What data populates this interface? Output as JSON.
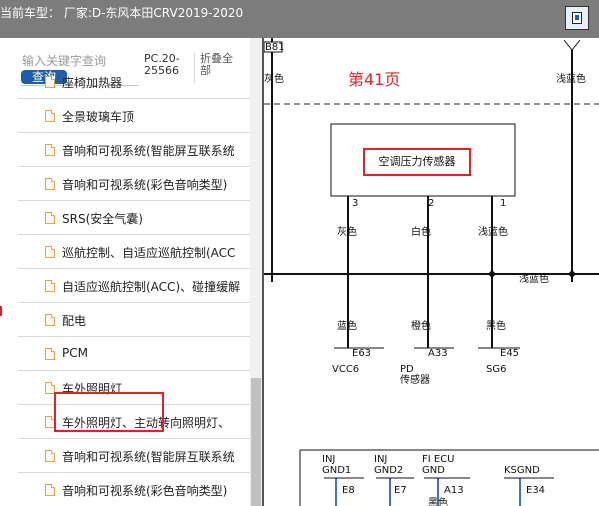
{
  "window": {
    "title": "当前车型：  厂家:D-东风本田CRV2019-2020"
  },
  "sidebar": {
    "search_placeholder": "输入关键字查询",
    "query_label": "查询",
    "page_code_line1": "PC.20-",
    "page_code_line2": "25566",
    "collapse_line1": "折叠全",
    "collapse_line2": "部",
    "items": [
      {
        "label": "座椅加热器"
      },
      {
        "label": "全景玻璃车顶"
      },
      {
        "label": "音响和可视系统(智能屏互联系统"
      },
      {
        "label": "音响和可视系统(彩色音响类型)"
      },
      {
        "label": "SRS(安全气囊)"
      },
      {
        "label": "巡航控制、自适应巡航控制(ACC"
      },
      {
        "label": "自适应巡航控制(ACC)、碰撞缓解"
      },
      {
        "label": "配电"
      },
      {
        "label": "PCM"
      },
      {
        "label": "车外照明灯"
      },
      {
        "label": "车外照明灯、主动转向照明灯、"
      },
      {
        "label": "音响和可视系统(智能屏互联系统"
      },
      {
        "label": "音响和可视系统(彩色音响类型)"
      }
    ]
  },
  "diagram": {
    "page_label": "第41页",
    "connector_top_left": "B81",
    "left_color_top": "灰色",
    "right_color_top": "浅蓝色",
    "sensor_name": "空调压力传感器",
    "pins": [
      {
        "num": "3",
        "color": "灰色",
        "lower_color": "蓝色",
        "terminal": "E63",
        "signal_line1": "VCC6",
        "signal_line2": ""
      },
      {
        "num": "2",
        "color": "白色",
        "lower_color": "橙色",
        "terminal": "A33",
        "signal_line1": "PD",
        "signal_line2": "传感器"
      },
      {
        "num": "1",
        "color": "浅蓝色",
        "lower_color": "黑色",
        "terminal": "E45",
        "signal_line1": "SG6",
        "signal_line2": ""
      }
    ],
    "junction_label": "浅蓝色",
    "bottom": [
      {
        "line1": "INJ",
        "line2": "GND1",
        "terminal": "E8"
      },
      {
        "line1": "INJ",
        "line2": "GND2",
        "terminal": "E7"
      },
      {
        "line1": "FI ECU",
        "line2": "GND",
        "terminal": "A13",
        "color": "黑色"
      },
      {
        "line1": "",
        "line2": "KSGND",
        "terminal": "E34"
      }
    ]
  },
  "colors": {
    "accent_red": "#e02424",
    "button_blue": "#1d5ea9",
    "titlebar_gray": "#7c7c7c",
    "wire_blue": "#3a73c8"
  }
}
